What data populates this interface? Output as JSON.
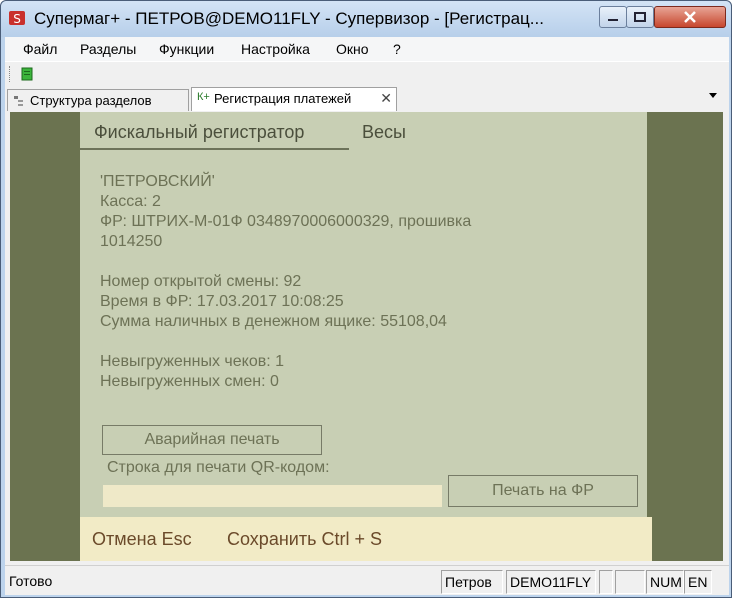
{
  "window": {
    "title": "Супермаг+ - ПЕТРОВ@DEMO11FLY - Супервизор  - [Регистрац...",
    "icon": "app-logo-icon"
  },
  "menu": [
    "Файл",
    "Разделы",
    "Функции",
    "Настройка",
    "Окно",
    "?"
  ],
  "toolbar": {
    "icon": "green-document-icon"
  },
  "tabs": [
    {
      "label": "Структура разделов",
      "icon": "tree-icon"
    },
    {
      "label": "Регистрация платежей",
      "icon_text": "К+",
      "close": "✕"
    }
  ],
  "panel_tabs": [
    "Фискальный регистратор",
    "Весы"
  ],
  "info": {
    "store": "'ПЕТРОВСКИЙ'",
    "cash_desk": "Касса: 2",
    "fr_line1": "ФР: ШТРИХ-М-01Ф 0348970006000329, прошивка",
    "fr_line2": "1014250",
    "shift_number": "Номер открытой смены: 92",
    "fr_time": "Время в ФР: 17.03.2017 10:08:25",
    "cash_sum": "Сумма наличных в денежном ящике: 55108,04",
    "unsent_checks": "Невыгруженных чеков: 1",
    "unsent_shifts": "Невыгруженных смен: 0"
  },
  "buttons": {
    "emergency_print": "Аварийная печать",
    "qr_label": "Строка для печати QR-кодом:",
    "qr_value": "",
    "print_fr": "Печать на ФР"
  },
  "bottom": {
    "cancel": "Отмена Esc",
    "save": "Сохранить Ctrl + S"
  },
  "status": {
    "text": "Готово",
    "cells": [
      "Петров",
      "DEMO11FLY",
      "",
      "NUM",
      "EN"
    ]
  },
  "colors": {
    "panel_bg": "#c8cfb4",
    "side_bg": "#6b7350",
    "bottom_bg": "#f2ebc6",
    "text": "#6d7256"
  }
}
